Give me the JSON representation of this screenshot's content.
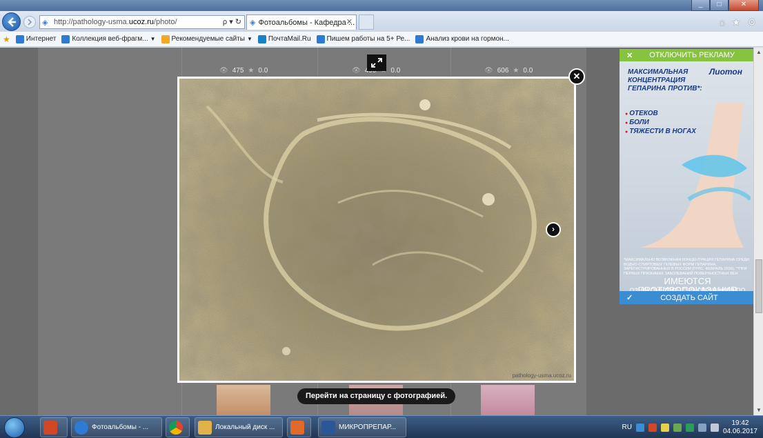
{
  "window": {
    "min": "_",
    "max": "□",
    "close": "✕"
  },
  "nav": {
    "url_prefix": "http://pathology-usma.",
    "url_domain": "ucoz.ru",
    "url_suffix": "/photo/",
    "search_refresh": "ρ ▾ ↻",
    "tab_title": "Фотоальбомы - Кафедра ...",
    "tab_close": "✕"
  },
  "favorites": [
    {
      "label": "Интернет",
      "icon": "ie",
      "dropdown": false
    },
    {
      "label": "Коллекция веб-фрагм...",
      "icon": "ie",
      "dropdown": true
    },
    {
      "label": "Рекомендуемые сайты",
      "icon": "bing",
      "dropdown": true
    },
    {
      "label": "ПочтаMail.Ru",
      "icon": "mail",
      "dropdown": false
    },
    {
      "label": "Пишем работы на 5+  Ре...",
      "icon": "ie",
      "dropdown": false
    },
    {
      "label": "Анализ крови на гормон...",
      "icon": "ie",
      "dropdown": false
    }
  ],
  "stats": [
    {
      "views": "475",
      "rating": "0.0"
    },
    {
      "views": "490",
      "rating": "0.0"
    },
    {
      "views": "606",
      "rating": "0.0"
    }
  ],
  "lightbox": {
    "watermark": "pathology-usma.ucoz.ru",
    "close": "✕",
    "next": "›",
    "goto_label": "Перейти на страницу с фотографией."
  },
  "ad": {
    "disable_label": "ОТКЛЮЧИТЬ РЕКЛАМУ",
    "brand": "Лиотон",
    "headline": "МАКСИМАЛЬНАЯ КОНЦЕНТРАЦИЯ ГЕПАРИНА ПРОТИВ*:",
    "bullets": [
      "ОТЕКОВ",
      "БОЛИ",
      "ТЯЖЕСТИ В НОГАХ"
    ],
    "fine_print": "*МАКСИМАЛЬНО ВОЗМОЖНАЯ КОНЦЕНТРАЦИЯ ГЕПАРИНА СРЕДИ ВОДНО-СПИРТОВЫХ ГЕЛЕВЫХ ФОРМ ГЕПАРИНА, ЗАРЕГИСТРИРОВАННЫХ В РОССИИ (ГРЛС, ФЕВРАЛЬ 2016). **ПРИ ПЕРВЫХ ПРИЗНАКАХ ЗАБОЛЕВАНИЙ ПОВЕРХНОСТНЫХ ВЕН",
    "warning": "ИМЕЮТСЯ ПРОТИВОПОКАЗАНИЯ",
    "warning_sub": "ОЗНАКОМЬТЕСЬ С ИНСТРУКЦИЕЙ ПО ПРИМЕНЕНИЮ",
    "create_site": "СОЗДАТЬ САЙТ"
  },
  "taskbar": {
    "apps": [
      {
        "label": "",
        "color": "#d24726"
      },
      {
        "label": "Фотоальбомы - ...",
        "color": "#2d7bd4"
      },
      {
        "label": "",
        "color": "#e8b81a"
      },
      {
        "label": "Локальный диск ...",
        "color": "#e2b24a"
      },
      {
        "label": "",
        "color": "#e06a2a"
      },
      {
        "label": "МИКРОПРЕПАР...",
        "color": "#2b5797"
      }
    ],
    "lang": "RU",
    "time": "19:42",
    "date": "04.06.2017"
  }
}
